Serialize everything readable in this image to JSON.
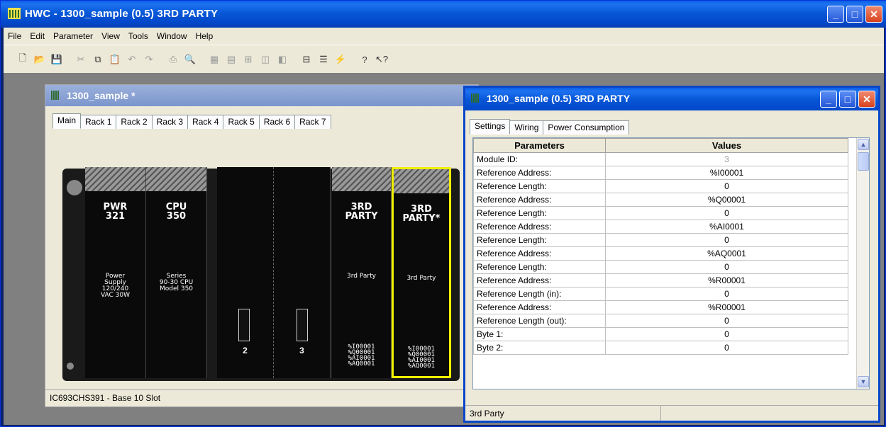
{
  "app": {
    "title": "HWC - 1300_sample (0.5) 3RD PARTY"
  },
  "menu": [
    "File",
    "Edit",
    "Parameter",
    "View",
    "Tools",
    "Window",
    "Help"
  ],
  "toolbar": {
    "icons": [
      "new-icon",
      "open-icon",
      "save-icon",
      "cut-icon",
      "copy-icon",
      "paste-icon",
      "undo-icon",
      "redo-icon",
      "print-icon",
      "print-preview-icon",
      "grid-icon",
      "grid-alt-icon",
      "insert-module-icon",
      "module-icon",
      "module-alt-icon",
      "xref-icon",
      "report-icon",
      "verify-icon",
      "help-icon",
      "context-help-icon"
    ]
  },
  "rackWindow": {
    "title": "1300_sample *",
    "tabs": [
      "Main",
      "Rack 1",
      "Rack 2",
      "Rack 3",
      "Rack 4",
      "Rack 5",
      "Rack 6",
      "Rack 7"
    ],
    "status": "IC693CHS391 - Base 10 Slot",
    "modules": [
      {
        "title1": "PWR",
        "title2": "321",
        "desc": [
          "Power",
          "Supply",
          "120/240",
          "VAC 30W"
        ]
      },
      {
        "title1": "CPU",
        "title2": "350",
        "desc": [
          "Series",
          "90-30 CPU",
          "Model 350"
        ]
      },
      {
        "slot": "2"
      },
      {
        "slot": "3"
      },
      {
        "title1": "3RD",
        "title2": "PARTY",
        "desc": [
          "3rd Party"
        ],
        "refs": [
          "%I00001",
          "%Q00001",
          "%AI0001",
          "%AQ0001"
        ]
      },
      {
        "title1": "3RD",
        "title2": "PARTY*",
        "desc": [
          "3rd Party"
        ],
        "refs": [
          "%I00001",
          "%Q00001",
          "%AI0001",
          "%AQ0001"
        ]
      }
    ]
  },
  "paramWindow": {
    "title": "1300_sample (0.5) 3RD PARTY",
    "tabs": [
      "Settings",
      "Wiring",
      "Power Consumption"
    ],
    "headers": {
      "param": "Parameters",
      "value": "Values"
    },
    "rows": [
      {
        "p": "Module ID:",
        "v": "3"
      },
      {
        "p": "Reference Address:",
        "v": "%I00001"
      },
      {
        "p": "Reference Length:",
        "v": "0"
      },
      {
        "p": "Reference Address:",
        "v": "%Q00001"
      },
      {
        "p": "Reference Length:",
        "v": "0"
      },
      {
        "p": "Reference Address:",
        "v": "%AI0001"
      },
      {
        "p": "Reference Length:",
        "v": "0"
      },
      {
        "p": "Reference Address:",
        "v": "%AQ0001"
      },
      {
        "p": "Reference Length:",
        "v": "0"
      },
      {
        "p": "Reference Address:",
        "v": "%R00001"
      },
      {
        "p": "Reference Length (in):",
        "v": "0"
      },
      {
        "p": "Reference Address:",
        "v": "%R00001"
      },
      {
        "p": "Reference Length (out):",
        "v": "0"
      },
      {
        "p": "Byte 1:",
        "v": "0"
      },
      {
        "p": "Byte 2:",
        "v": "0"
      }
    ],
    "status": "3rd Party"
  }
}
